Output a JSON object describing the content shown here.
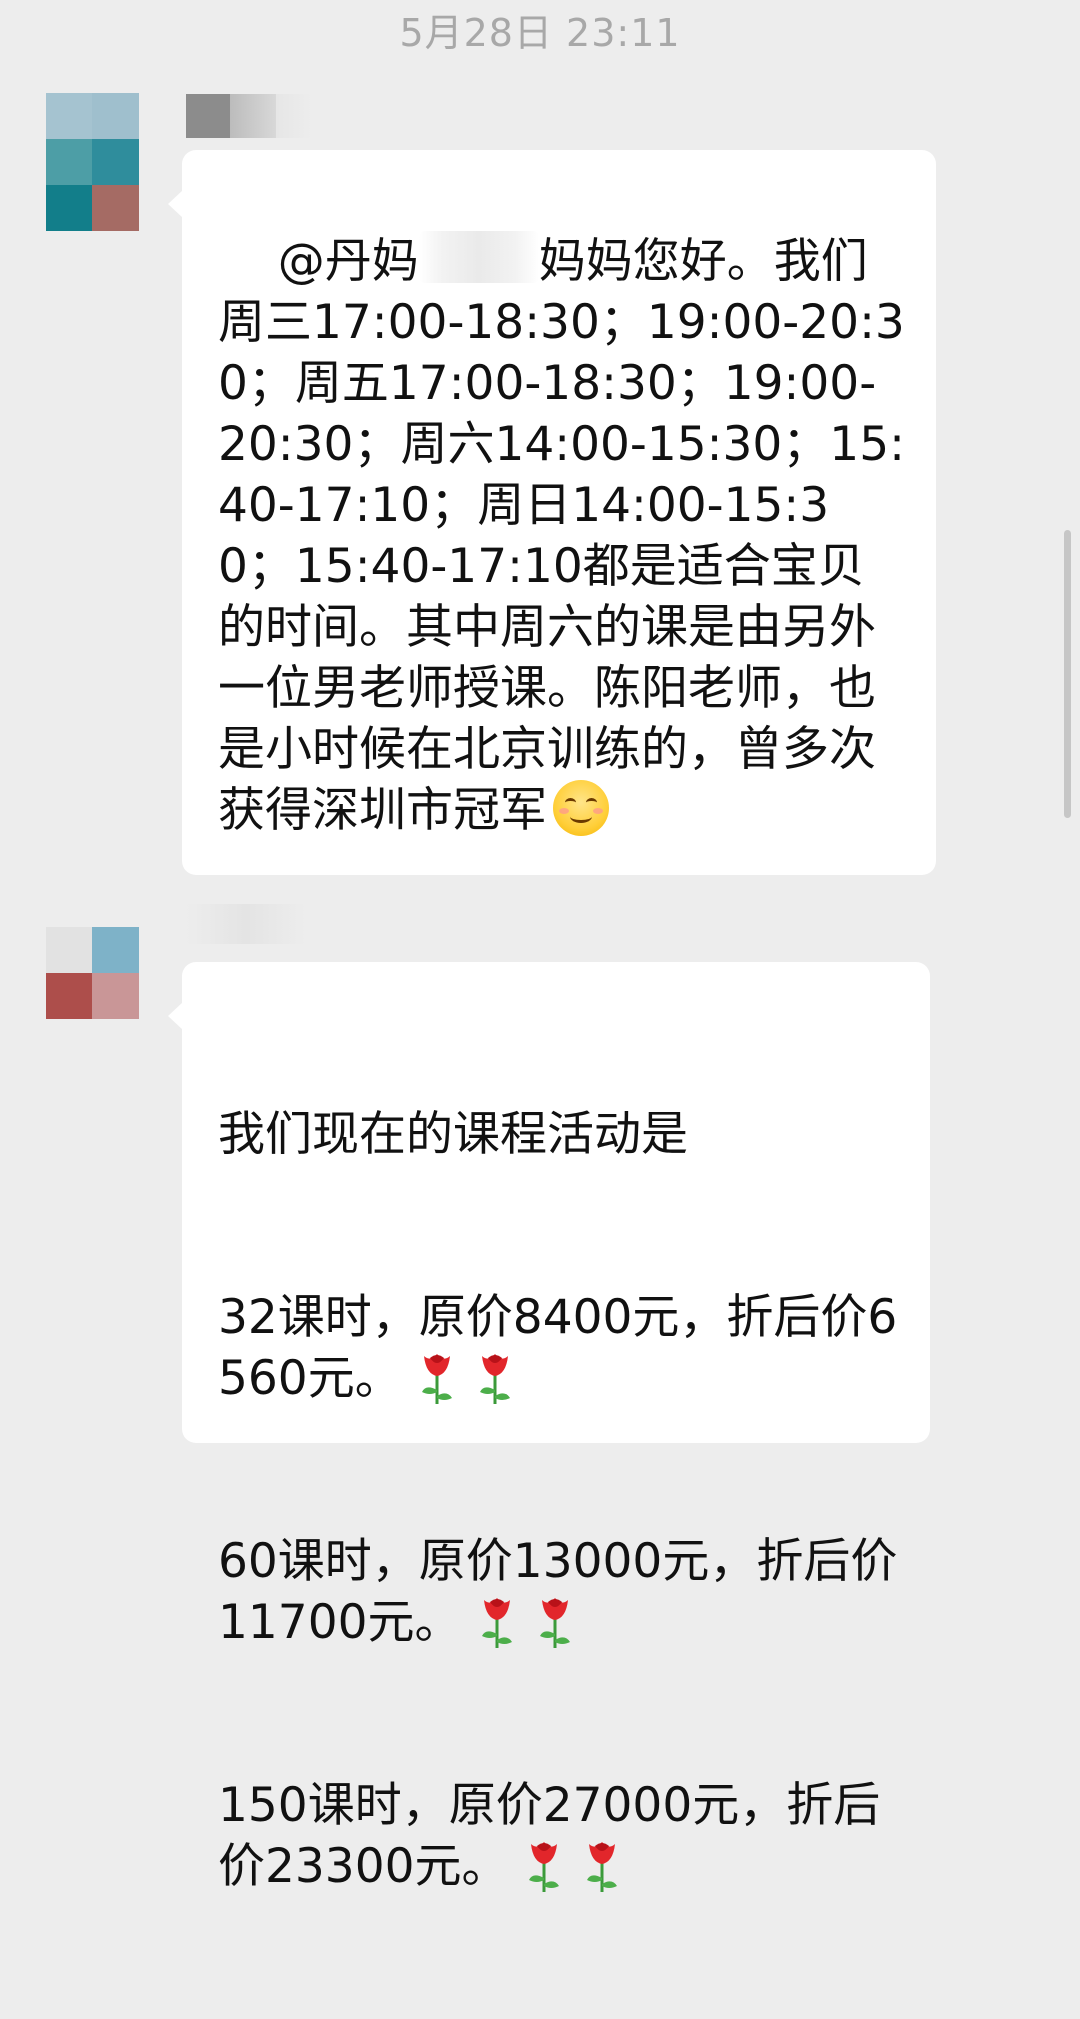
{
  "chat": {
    "timestamp": "5月28日 23:11",
    "messages": [
      {
        "sender_name": "",
        "avatar_colors": [
          "#a5c3d0",
          "#9fbfcd",
          "#4d9ea6",
          "#2f8d9c",
          "#127e8a",
          "#a56b64"
        ],
        "text_before_mask": "@丹妈",
        "text_after_mask": "妈妈您好。我们周三17:00-18:30；19:00-20:30；周五17:00-18:30；19:00-20:30；周六14:00-15:30；15:40-17:10；周日14:00-15:30；15:40-17:10都是适合宝贝的时间。其中周六的课是由另外一位男老师授课。陈阳老师，也是小时候在北京训练的，曾多次获得深圳市冠军",
        "emoji": "smiling-face-icon"
      },
      {
        "sender_name": "",
        "avatar_colors": [
          "#e2e2e2",
          "#7eb2c8",
          "#ad4e4b",
          "#c99697"
        ],
        "lines": [
          "我们现在的课程活动是",
          "32课时，原价8400元，折后价6560元。",
          "60课时，原价13000元，折后价11700元。",
          "150课时，原价27000元，折后价23300元。"
        ],
        "emoji": "rose-icon"
      }
    ]
  },
  "colors": {
    "background": "#ededed",
    "bubble": "#ffffff",
    "timestamp_text": "#a8a8a8",
    "message_text": "#111111"
  }
}
